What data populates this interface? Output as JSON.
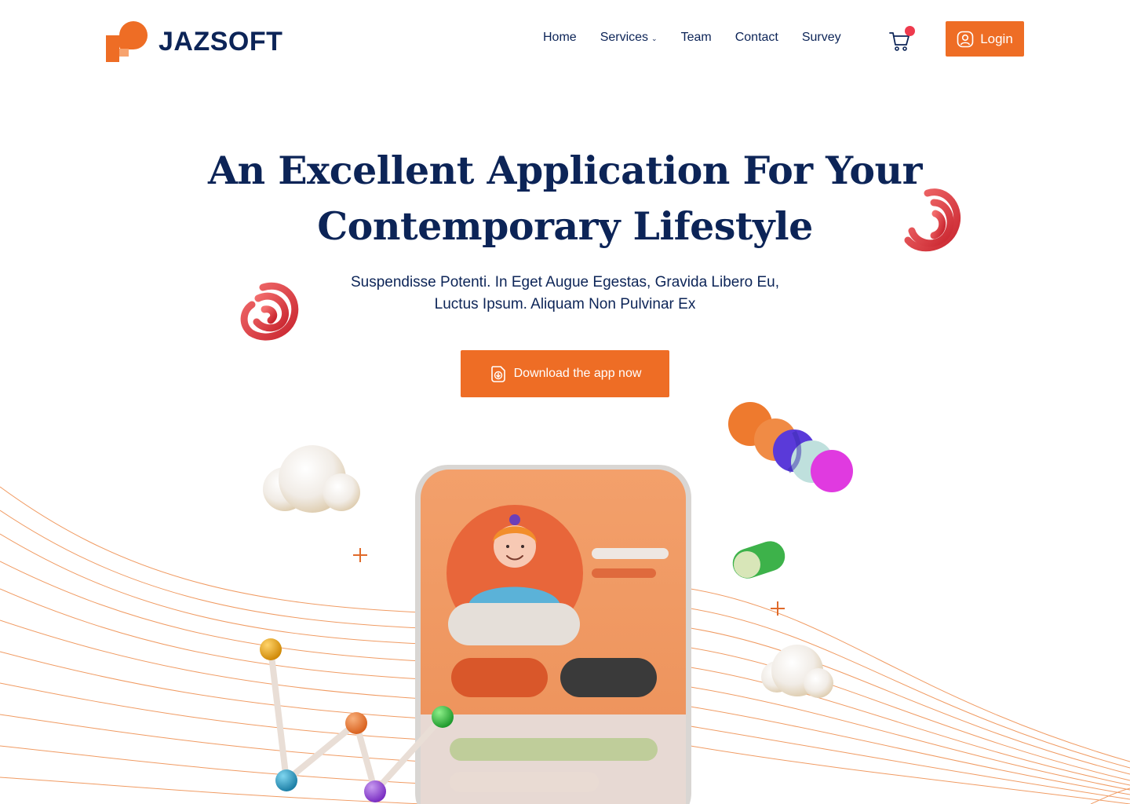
{
  "brand": {
    "name": "JAZSOFT",
    "accent": "#ee6d25",
    "navy": "#0c2457"
  },
  "nav": {
    "items": [
      {
        "label": "Home"
      },
      {
        "label": "Services",
        "has_dropdown": true
      },
      {
        "label": "Team"
      },
      {
        "label": "Contact"
      },
      {
        "label": "Survey"
      }
    ],
    "cart_icon": "cart-icon",
    "cart_badge_color": "#ee3a4d",
    "login_label": "Login"
  },
  "hero": {
    "title_line1": "An Excellent Application For Your",
    "title_line2": "Contemporary Lifestyle",
    "subtitle_line1": "Suspendisse Potenti. In Eget Augue Egestas, Gravida Libero Eu,",
    "subtitle_line2": "Luctus Ipsum. Aliquam Non Pulvinar Ex",
    "cta_label": "Download the app now"
  }
}
